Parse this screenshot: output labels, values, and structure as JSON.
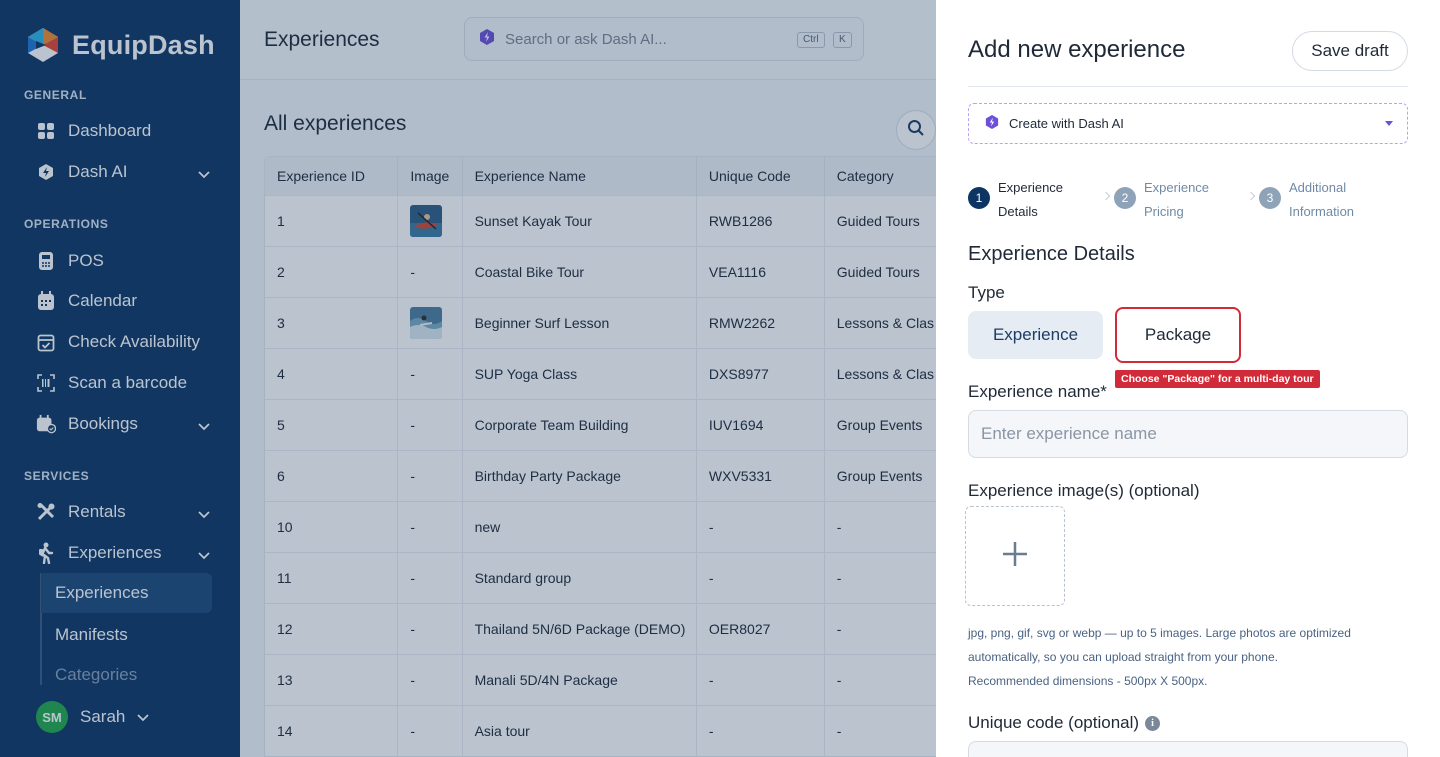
{
  "app": {
    "name": "EquipDash"
  },
  "sidebar": {
    "sections": {
      "general": "GENERAL",
      "operations": "OPERATIONS",
      "services": "SERVICES"
    },
    "items": {
      "dashboard": "Dashboard",
      "dash_ai": "Dash AI",
      "pos": "POS",
      "calendar": "Calendar",
      "check_availability": "Check Availability",
      "scan_barcode": "Scan a barcode",
      "bookings": "Bookings",
      "rentals": "Rentals",
      "experiences": "Experiences"
    },
    "subitems": {
      "experiences": "Experiences",
      "manifests": "Manifests",
      "categories": "Categories"
    },
    "user": {
      "initials": "SM",
      "name": "Sarah"
    }
  },
  "header": {
    "title": "Experiences",
    "search_placeholder": "Search or ask Dash AI...",
    "kbd_ctrl": "Ctrl",
    "kbd_k": "K"
  },
  "list": {
    "title": "All experiences",
    "columns": [
      "Experience ID",
      "Image",
      "Experience Name",
      "Unique Code",
      "Category"
    ],
    "rows": [
      {
        "id": "1",
        "image": "kayak",
        "name": "Sunset Kayak Tour",
        "code": "RWB1286",
        "category": "Guided Tours"
      },
      {
        "id": "2",
        "image": "-",
        "name": "Coastal Bike Tour",
        "code": "VEA1116",
        "category": "Guided Tours"
      },
      {
        "id": "3",
        "image": "surf",
        "name": "Beginner Surf Lesson",
        "code": "RMW2262",
        "category": "Lessons & Clas"
      },
      {
        "id": "4",
        "image": "-",
        "name": "SUP Yoga Class",
        "code": "DXS8977",
        "category": "Lessons & Clas"
      },
      {
        "id": "5",
        "image": "-",
        "name": "Corporate Team Building",
        "code": "IUV1694",
        "category": "Group Events"
      },
      {
        "id": "6",
        "image": "-",
        "name": "Birthday Party Package",
        "code": "WXV5331",
        "category": "Group Events"
      },
      {
        "id": "10",
        "image": "-",
        "name": "new",
        "code": "-",
        "category": "-"
      },
      {
        "id": "11",
        "image": "-",
        "name": "Standard group",
        "code": "-",
        "category": "-"
      },
      {
        "id": "12",
        "image": "-",
        "name": "Thailand 5N/6D Package (DEMO)",
        "code": "OER8027",
        "category": "-"
      },
      {
        "id": "13",
        "image": "-",
        "name": "Manali 5D/4N Package",
        "code": "-",
        "category": "-"
      },
      {
        "id": "14",
        "image": "-",
        "name": "Asia tour",
        "code": "-",
        "category": "-"
      }
    ]
  },
  "drawer": {
    "title": "Add new experience",
    "save_draft": "Save draft",
    "ai_select": "Create with Dash AI",
    "steps": [
      {
        "num": "1",
        "line1": "Experience",
        "line2": "Details",
        "state": "active"
      },
      {
        "num": "2",
        "line1": "Experience",
        "line2": "Pricing",
        "state": "inactive"
      },
      {
        "num": "3",
        "line1": "Additional",
        "line2": "Information",
        "state": "inactive"
      }
    ],
    "section_title": "Experience Details",
    "type_label": "Type",
    "type_experience": "Experience",
    "type_package": "Package",
    "hint": "Choose \"Package\" for a multi-day tour",
    "name_label": "Experience name*",
    "name_placeholder": "Enter experience name",
    "images_label": "Experience image(s) (optional)",
    "images_help_1": "jpg, png, gif, svg or webp — up to 5 images. Large photos are optimized",
    "images_help_2": "automatically, so you can upload straight from your phone.",
    "images_help_3": "Recommended dimensions - 500px X 500px.",
    "code_label": "Unique code (optional)"
  },
  "colors": {
    "sidebar_bg": "#0c3563",
    "accent_red": "#d12b3a",
    "step_active": "#0c3563",
    "step_inactive": "#8fa3b8",
    "ai_purple": "#6d4fd8"
  }
}
